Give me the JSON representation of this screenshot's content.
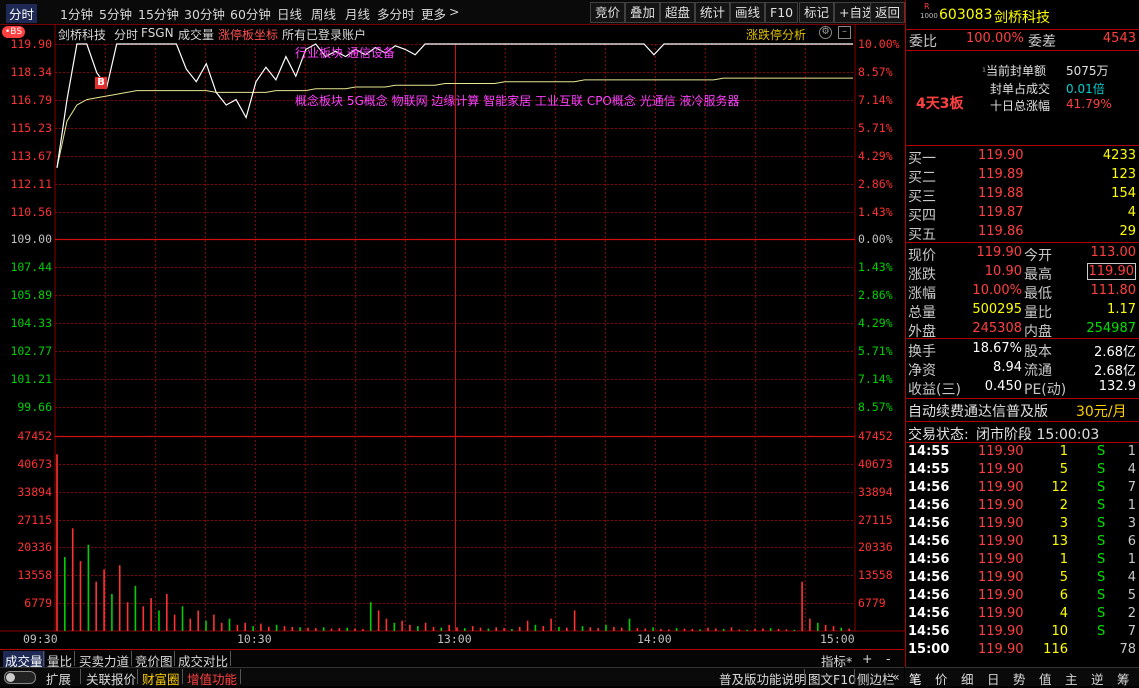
{
  "toolbar": {
    "periods": [
      "分时",
      "1分钟",
      "5分钟",
      "15分钟",
      "30分钟",
      "60分钟",
      "日线",
      "周线",
      "月线",
      "多分时",
      "更多"
    ],
    "more_arrow": ">",
    "buttons": [
      "竞价",
      "叠加",
      "超盘",
      "统计",
      "画线",
      "F10",
      "标记",
      "+自选",
      "返回"
    ]
  },
  "chart_header": {
    "bs_badge": "•BS",
    "stock_name": "剑桥科技",
    "mode": "分时",
    "indicator": "FSGN",
    "volume_label": "成交量",
    "limit_label": "涨停板坐标",
    "account_label": "所有已登录账户",
    "limit_analysis": "涨跌停分析"
  },
  "annotations": {
    "industry": "行业板块  通信设备",
    "concept": "概念板块  5G概念  物联网  边缘计算  智能家居  工业互联  CPO概念  光通信  液冷服务器",
    "buy_marker": "B"
  },
  "price_axis": {
    "left": [
      "119.90",
      "118.34",
      "116.79",
      "115.23",
      "113.67",
      "112.11",
      "110.56",
      "109.00",
      "107.44",
      "105.89",
      "104.33",
      "102.77",
      "101.21",
      "99.66"
    ],
    "right": [
      "10.00%",
      "8.57%",
      "7.14%",
      "5.71%",
      "4.29%",
      "2.86%",
      "1.43%",
      "0.00%",
      "1.43%",
      "2.86%",
      "4.29%",
      "5.71%",
      "7.14%",
      "8.57%"
    ]
  },
  "volume_axis": [
    "47452",
    "40673",
    "33894",
    "27115",
    "20336",
    "13558",
    "6779"
  ],
  "time_axis": [
    "09:30",
    "10:30",
    "13:00",
    "14:00",
    "15:00"
  ],
  "chart_data": {
    "type": "line",
    "x_ticks": [
      "09:30",
      "10:30",
      "13:00",
      "14:00",
      "15:00"
    ],
    "ylim": [
      99.66,
      119.9
    ],
    "prev_close": 109.0,
    "series": [
      {
        "values": [
          113.0,
          116.8,
          119.9,
          119.9,
          118.3,
          117.5,
          119.9,
          119.9,
          119.9,
          119.9,
          119.9,
          119.9,
          119.9,
          118.5,
          117.8,
          118.8,
          117.2,
          116.5,
          116.8,
          115.8,
          117.8,
          118.6,
          117.9,
          119.2,
          118.1,
          119.6,
          119.9,
          119.2,
          119.5,
          119.2,
          119.6,
          119.3,
          119.7,
          119.4,
          119.8,
          119.6,
          119.3,
          119.9,
          119.9,
          119.9,
          119.9,
          119.9,
          119.9,
          119.9,
          119.9,
          119.9,
          119.9,
          119.9,
          119.9,
          119.9,
          119.9,
          119.9,
          119.9,
          119.9,
          119.9,
          119.9,
          119.9,
          119.9,
          119.9,
          119.9,
          119.3,
          119.9,
          119.9,
          119.9,
          119.9,
          119.9,
          119.9,
          119.9,
          119.9,
          119.9,
          119.9,
          119.9,
          119.9,
          119.9,
          119.9,
          119.9,
          119.9,
          119.9,
          119.9,
          119.9,
          119.9
        ]
      },
      {
        "values": [
          113.0,
          115.6,
          116.5,
          116.8,
          116.9,
          117.0,
          117.1,
          117.2,
          117.3,
          117.3,
          117.3,
          117.3,
          117.3,
          117.3,
          117.3,
          117.3,
          117.2,
          117.2,
          117.2,
          117.2,
          117.2,
          117.2,
          117.3,
          117.3,
          117.3,
          117.3,
          117.4,
          117.4,
          117.4,
          117.4,
          117.5,
          117.5,
          117.5,
          117.5,
          117.6,
          117.6,
          117.6,
          117.6,
          117.6,
          117.7,
          117.7,
          117.7,
          117.7,
          117.7,
          117.7,
          117.8,
          117.8,
          117.8,
          117.8,
          117.8,
          117.8,
          117.8,
          117.8,
          117.9,
          117.9,
          117.9,
          117.9,
          117.9,
          117.9,
          117.9,
          117.9,
          117.9,
          117.9,
          117.9,
          117.9,
          117.9,
          117.9,
          118.0,
          118.0,
          118.0,
          118.0,
          118.0,
          118.0,
          118.0,
          118.0,
          118.0,
          118.0,
          118.0,
          118.0,
          118.0,
          118.0
        ]
      }
    ],
    "volume": [
      43000,
      18000,
      25000,
      17000,
      21000,
      12000,
      15000,
      9000,
      16000,
      7000,
      11000,
      6000,
      8000,
      5000,
      9000,
      4000,
      6000,
      3000,
      5000,
      2500,
      4000,
      2000,
      3000,
      1500,
      2000,
      1200,
      1800,
      1000,
      1500,
      1200,
      1000,
      900,
      800,
      700,
      900,
      600,
      700,
      800,
      600,
      500,
      7000,
      5000,
      3000,
      2000,
      2500,
      1500,
      1200,
      2000,
      1000,
      800,
      1500,
      900,
      700,
      1200,
      800,
      600,
      900,
      700,
      500,
      1000,
      2500,
      1500,
      1200,
      3000,
      1000,
      800,
      5000,
      1200,
      900,
      700,
      1500,
      1000,
      800,
      3000,
      700,
      600,
      900,
      500,
      400,
      700,
      600,
      500,
      400,
      800,
      600,
      500,
      900,
      400,
      300,
      500,
      600,
      700,
      500,
      400,
      300,
      12000,
      3000,
      2000,
      1500,
      1200,
      800,
      600
    ]
  },
  "quote": {
    "market_tag": "R",
    "board_code": "1000",
    "code": "603083",
    "name": "剑桥科技",
    "webi_label": "委比",
    "webi_value": "100.00%",
    "weicha_label": "委差",
    "weicha_value": "4543",
    "seal_label": "当前封单额",
    "seal_value": "5075万",
    "seal_ratio_label": "封单占成交",
    "seal_ratio_value": "0.01倍",
    "ten_day_label": "十日总涨幅",
    "ten_day_value": "41.79%",
    "board_count": "4天3板",
    "bids": [
      {
        "label": "买一",
        "price": "119.90",
        "vol": "4233"
      },
      {
        "label": "买二",
        "price": "119.89",
        "vol": "123"
      },
      {
        "label": "买三",
        "price": "119.88",
        "vol": "154"
      },
      {
        "label": "买四",
        "price": "119.87",
        "vol": "4"
      },
      {
        "label": "买五",
        "price": "119.86",
        "vol": "29"
      }
    ],
    "stats": [
      {
        "l1": "现价",
        "v1": "119.90",
        "l2": "今开",
        "v2": "113.00"
      },
      {
        "l1": "涨跌",
        "v1": "10.90",
        "l2": "最高",
        "v2": "119.90"
      },
      {
        "l1": "涨幅",
        "v1": "10.00%",
        "l2": "最低",
        "v2": "111.80"
      },
      {
        "l1": "总量",
        "v1": "500295",
        "l2": "量比",
        "v2": "1.17"
      },
      {
        "l1": "外盘",
        "v1": "245308",
        "l2": "内盘",
        "v2": "254987"
      }
    ],
    "stats2": [
      {
        "l1": "换手",
        "v1": "18.67%",
        "l2": "股本",
        "v2": "2.68亿"
      },
      {
        "l1": "净资",
        "v1": "8.94",
        "l2": "流通",
        "v2": "2.68亿"
      },
      {
        "l1": "收益(三)",
        "v1": "0.450",
        "l2": "PE(动)",
        "v2": "132.9"
      }
    ],
    "ad_text": "自动续费通达信普及版",
    "ad_price": "30元/月",
    "status_label": "交易状态:",
    "status_value": "闭市阶段 15:00:03",
    "ticks": [
      {
        "t": "14:55",
        "p": "119.90",
        "v": "1",
        "s": "S",
        "n": "1"
      },
      {
        "t": "14:55",
        "p": "119.90",
        "v": "5",
        "s": "S",
        "n": "4"
      },
      {
        "t": "14:56",
        "p": "119.90",
        "v": "12",
        "s": "S",
        "n": "7"
      },
      {
        "t": "14:56",
        "p": "119.90",
        "v": "2",
        "s": "S",
        "n": "1"
      },
      {
        "t": "14:56",
        "p": "119.90",
        "v": "3",
        "s": "S",
        "n": "3"
      },
      {
        "t": "14:56",
        "p": "119.90",
        "v": "13",
        "s": "S",
        "n": "6"
      },
      {
        "t": "14:56",
        "p": "119.90",
        "v": "1",
        "s": "S",
        "n": "1"
      },
      {
        "t": "14:56",
        "p": "119.90",
        "v": "5",
        "s": "S",
        "n": "4"
      },
      {
        "t": "14:56",
        "p": "119.90",
        "v": "6",
        "s": "S",
        "n": "5"
      },
      {
        "t": "14:56",
        "p": "119.90",
        "v": "4",
        "s": "S",
        "n": "2"
      },
      {
        "t": "14:56",
        "p": "119.90",
        "v": "10",
        "s": "S",
        "n": "7"
      },
      {
        "t": "15:00",
        "p": "119.90",
        "v": "116",
        "s": "",
        "n": "78"
      }
    ],
    "bottom_tabs": [
      "笔",
      "价",
      "细",
      "日",
      "势",
      "值",
      "主",
      "逆",
      "筹"
    ]
  },
  "bottom": {
    "tabs": [
      "成交量",
      "量比",
      "买卖力道",
      "竞价图",
      "成交对比"
    ],
    "indicator_label": "指标*",
    "plus": "+",
    "minus": "-",
    "toggle": "扩展",
    "links": [
      "关联报价",
      "财富圈",
      "增值功能"
    ],
    "right_links": [
      "普及版功能说明",
      "图文F10",
      "侧边栏"
    ],
    "right_arrow": "«"
  },
  "colors": {
    "grid": "#8b0000",
    "up": "#ff3232",
    "down": "#00d000",
    "price_line": "#ffffff",
    "avg_line": "#e8e890",
    "accent_magenta": "#ff40ff",
    "neutral": "#c0c0c0"
  }
}
